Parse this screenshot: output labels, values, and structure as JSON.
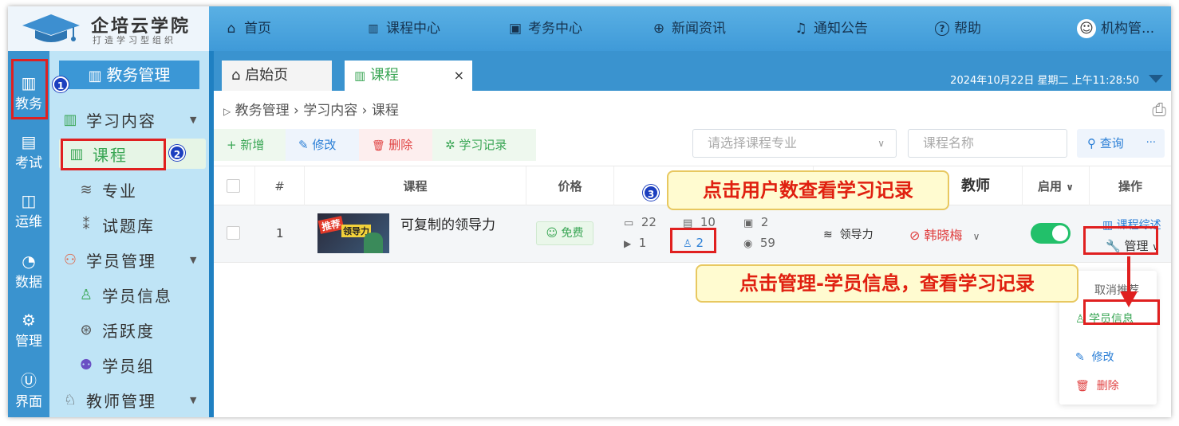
{
  "app": {
    "logo_title": "企培云学院",
    "logo_subtitle": "打造学习型组织"
  },
  "topnav": [
    {
      "icon": "home-icon",
      "glyph": "⌂",
      "label": "首页"
    },
    {
      "icon": "book-open-icon",
      "glyph": "📖",
      "label": "课程中心"
    },
    {
      "icon": "exam-icon",
      "glyph": "▣",
      "label": "考务中心"
    },
    {
      "icon": "news-icon",
      "glyph": "⊕",
      "label": "新闻资讯"
    },
    {
      "icon": "bell-icon",
      "glyph": "♫",
      "label": "通知公告"
    },
    {
      "icon": "help-icon",
      "glyph": "?",
      "label": "帮助"
    },
    {
      "icon": "user-avatar-icon",
      "glyph": "☺",
      "label": "机构管..."
    }
  ],
  "iconcol": [
    {
      "icon": "books-icon",
      "glyph": "▥",
      "label": "教务"
    },
    {
      "icon": "exam-100-icon",
      "glyph": "▤",
      "label": "考试"
    },
    {
      "icon": "ops-icon",
      "glyph": "◫",
      "label": "运维"
    },
    {
      "icon": "pie-chart-icon",
      "glyph": "◔",
      "label": "数据"
    },
    {
      "icon": "gear-icon",
      "glyph": "⚙",
      "label": "管理"
    },
    {
      "icon": "ui-icon",
      "glyph": "Ⓤ",
      "label": "界面"
    }
  ],
  "menu": {
    "header": "教务管理",
    "items": [
      {
        "icon": "book-open-icon",
        "glyph": "📖",
        "label": "学习内容",
        "has_arrow": true
      },
      {
        "icon": "book-open-icon",
        "glyph": "📖",
        "label": "课程",
        "active": true
      },
      {
        "icon": "layers-icon",
        "glyph": "≋",
        "label": "专业"
      },
      {
        "icon": "question-bank-icon",
        "glyph": "⁑",
        "label": "试题库"
      },
      {
        "icon": "students-icon",
        "glyph": "⚇",
        "label": "学员管理",
        "has_arrow": true
      },
      {
        "icon": "user-icon",
        "glyph": "♙",
        "label": "学员信息"
      },
      {
        "icon": "activity-icon",
        "glyph": "⊛",
        "label": "活跃度"
      },
      {
        "icon": "group-icon",
        "glyph": "⚉",
        "label": "学员组"
      },
      {
        "icon": "teacher-icon",
        "glyph": "♘",
        "label": "教师管理",
        "has_arrow": true
      }
    ]
  },
  "tabs": [
    {
      "icon": "home-icon",
      "glyph": "⌂",
      "label": "启始页"
    },
    {
      "icon": "book-open-icon",
      "glyph": "📖",
      "label": "课程",
      "close": "×"
    }
  ],
  "datetime": "2024年10月22日 星期二 上午11:28:50",
  "breadcrumb": {
    "arrow": "▷",
    "path": [
      "教务管理",
      "学习内容",
      "课程"
    ],
    "sep": "›"
  },
  "toolbar": {
    "add": {
      "glyph": "+",
      "label": "新增"
    },
    "edit": {
      "glyph": "✎",
      "label": "修改"
    },
    "delete": {
      "glyph": "🗑",
      "label": "删除"
    },
    "records": {
      "glyph": "✲",
      "label": "学习记录"
    },
    "major_placeholder": "请选择课程专业",
    "name_placeholder": "课程名称",
    "search_label": "查询",
    "more": "···"
  },
  "table": {
    "headers": {
      "index": "#",
      "course": "课程",
      "price": "价格",
      "teacher": "教师",
      "enabled": "启用",
      "ops": "操作"
    },
    "row": {
      "index": "1",
      "thumb_tag": "推荐",
      "thumb_text": "领导力",
      "course_name": "可复制的领导力",
      "price": "免费",
      "lessons": "22",
      "videos": "1",
      "chapters": "10",
      "users": "2",
      "questions": "2",
      "views": "59",
      "major": "领导力",
      "teacher": "韩晓梅",
      "ops_summary": "课程综述",
      "ops_manage": "管理"
    }
  },
  "popup": {
    "item1": "取消推荐",
    "student_info": "学员信息",
    "edit": "修改",
    "delete": "删除"
  },
  "annotations": {
    "badge1": "1",
    "badge2": "2",
    "badge3": "3",
    "callout1": "点击用户数查看学习记录",
    "callout2": "点击管理-学员信息，查看学习记录"
  },
  "colors": {
    "topbar": "#4aa5e0",
    "menu_bg": "#bfe4f6",
    "accent_green": "#3aa655",
    "danger_red": "#e02020",
    "link_blue": "#2b7fd6"
  }
}
